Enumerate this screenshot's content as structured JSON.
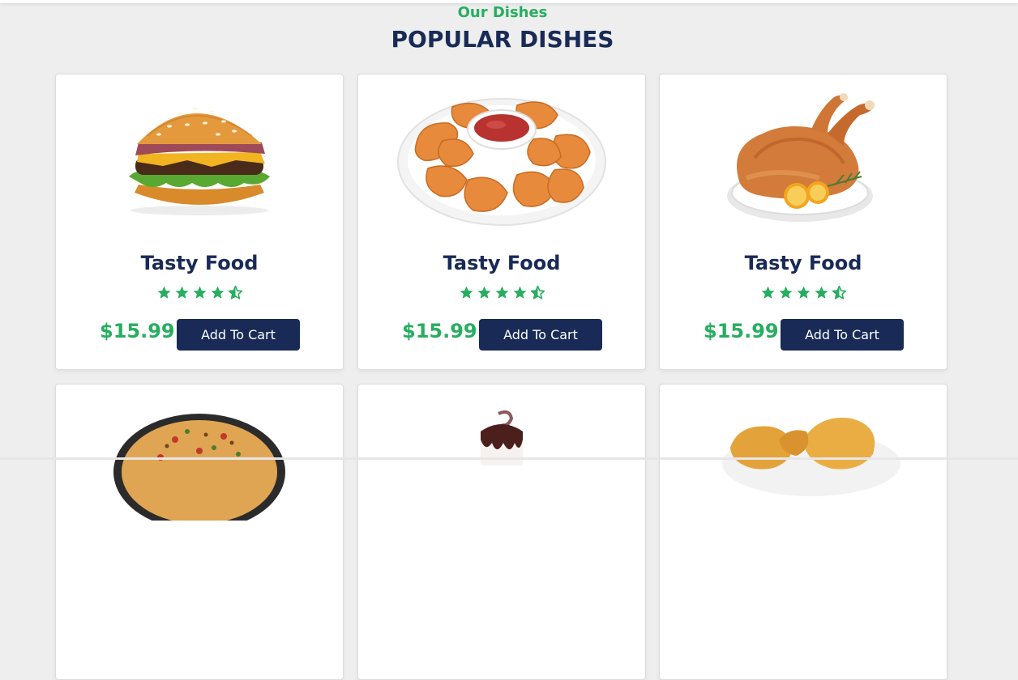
{
  "section": {
    "subtitle": "Our Dishes",
    "title": "POPULAR DISHES"
  },
  "colors": {
    "accent": "#27ae60",
    "navy": "#192a56",
    "background": "#eeeeee"
  },
  "dishes": [
    {
      "name": "Tasty Food",
      "price": "$15.99",
      "button": "Add To Cart",
      "rating": 4.5,
      "image": "burger-image"
    },
    {
      "name": "Tasty Food",
      "price": "$15.99",
      "button": "Add To Cart",
      "rating": 4.5,
      "image": "nuggets-image"
    },
    {
      "name": "Tasty Food",
      "price": "$15.99",
      "button": "Add To Cart",
      "rating": 4.5,
      "image": "roast-chicken-image"
    },
    {
      "image": "pizza-image"
    },
    {
      "image": "ice-cream-image"
    },
    {
      "image": "fried-chicken-image"
    }
  ]
}
